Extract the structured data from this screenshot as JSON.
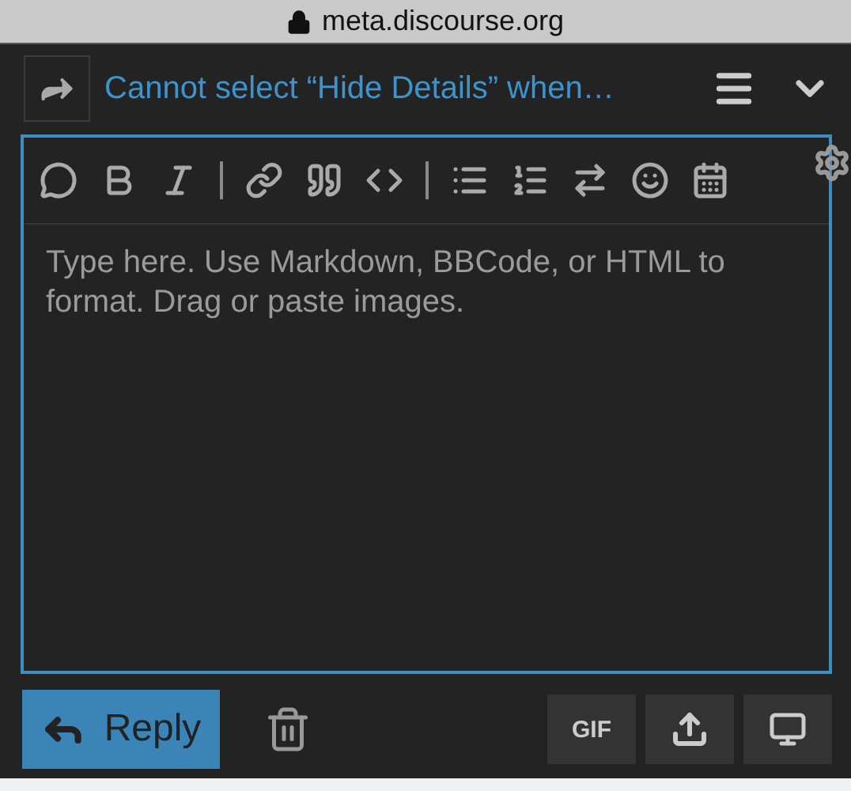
{
  "address_bar": {
    "url": "meta.discourse.org"
  },
  "composer": {
    "topic_title": "Cannot select “Hide Details” when…",
    "editor": {
      "placeholder": "Type here. Use Markdown, BBCode, or HTML to format. Drag or paste images."
    },
    "reply_button": "Reply",
    "gif_button": "GIF"
  }
}
